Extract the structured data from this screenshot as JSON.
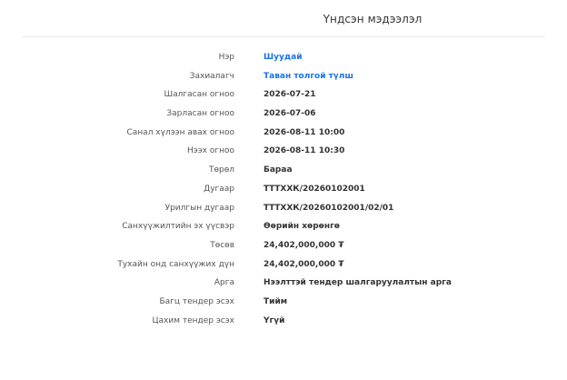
{
  "header": {
    "title": "Үндсэн мэдээлэл"
  },
  "colors": {
    "link": "#1a73e8",
    "label": "#555555",
    "value": "#333333"
  },
  "rows": [
    {
      "label": "Нэр",
      "value": "Шуудай",
      "link": true
    },
    {
      "label": "Захиалагч",
      "value": "Таван толгой түлш",
      "link": true
    },
    {
      "label": "Шалгасан огноо",
      "value": "2026-07-21"
    },
    {
      "label": "Зарласан огноо",
      "value": "2026-07-06"
    },
    {
      "label": "Санал хүлээн авах огноо",
      "value": "2026-08-11 10:00"
    },
    {
      "label": "Нээх огноо",
      "value": "2026-08-11 10:30"
    },
    {
      "label": "Төрөл",
      "value": "Бараа"
    },
    {
      "label": "Дугаар",
      "value": "ТТТХХК/20260102001"
    },
    {
      "label": "Урилгын дугаар",
      "value": "ТТТХХК/20260102001/02/01"
    },
    {
      "label": "Санхүүжилтийн эх үүсвэр",
      "value": "Өөрийн хөрөнгө"
    },
    {
      "label": "Төсөв",
      "value": "24,402,000,000 ₮"
    },
    {
      "label": "Тухайн онд санхүүжих дүн",
      "value": "24,402,000,000 ₮"
    },
    {
      "label": "Арга",
      "value": "Нээлттэй тендер шалгаруулалтын арга"
    },
    {
      "label": "Багц тендер эсэх",
      "value": "Тийм"
    },
    {
      "label": "Цахим тендер эсэх",
      "value": "Үгүй"
    }
  ]
}
